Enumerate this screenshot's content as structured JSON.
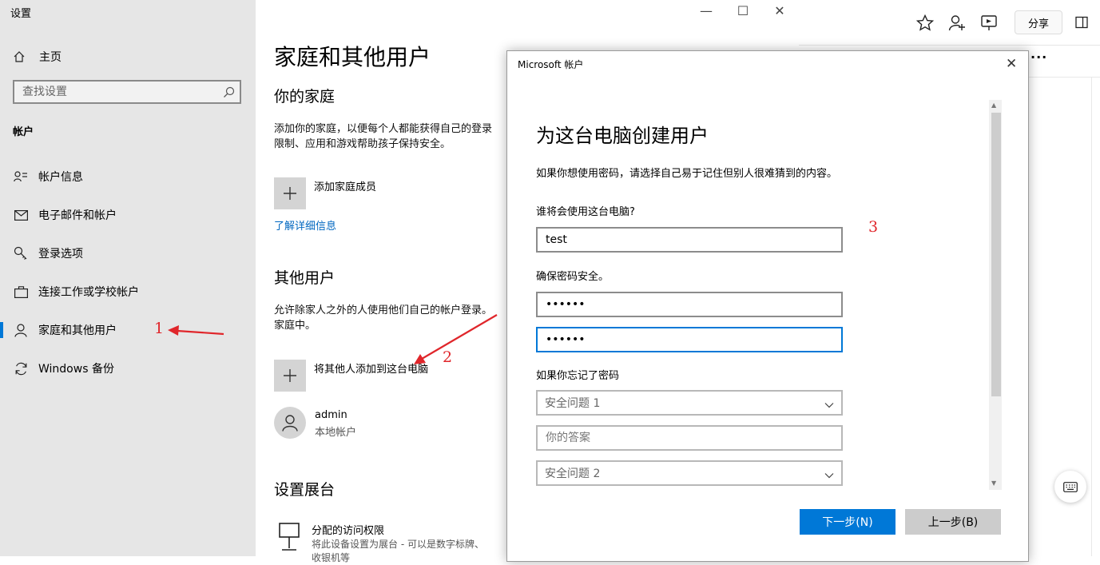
{
  "window": {
    "title": "设置"
  },
  "sidebar": {
    "home": "主页",
    "search_placeholder": "查找设置",
    "section": "帐户",
    "items": [
      {
        "label": "帐户信息",
        "icon": "person-card-icon"
      },
      {
        "label": "电子邮件和帐户",
        "icon": "mail-icon"
      },
      {
        "label": "登录选项",
        "icon": "key-icon"
      },
      {
        "label": "连接工作或学校帐户",
        "icon": "briefcase-icon"
      },
      {
        "label": "家庭和其他用户",
        "icon": "person-icon",
        "active": true
      },
      {
        "label": "Windows 备份",
        "icon": "sync-icon"
      }
    ]
  },
  "main": {
    "page_title": "家庭和其他用户",
    "family": {
      "heading": "你的家庭",
      "desc_line1": "添加你的家庭，以便每个人都能获得自己的登录",
      "desc_line2": "限制、应用和游戏帮助孩子保持安全。",
      "add_label": "添加家庭成员",
      "learn_more": "了解详细信息"
    },
    "others": {
      "heading": "其他用户",
      "desc_line1": "允许除家人之外的人使用他们自己的帐户登录。",
      "desc_line2": "家庭中。",
      "add_label": "将其他人添加到这台电脑"
    },
    "user": {
      "name": "admin",
      "type": "本地帐户"
    },
    "kiosk": {
      "heading": "设置展台",
      "item_title": "分配的访问权限",
      "item_desc": "将此设备设置为展台 - 可以是数字标牌、",
      "item_desc2": "收银机等"
    }
  },
  "browser": {
    "share_label": "分享",
    "more_label": "···"
  },
  "dialog": {
    "title": "Microsoft 帐户",
    "heading": "为这台电脑创建用户",
    "intro": "如果你想使用密码，请选择自己易于记住但别人很难猜到的内容。",
    "who_label": "谁将会使用这台电脑?",
    "username_value": "test",
    "password_label": "确保密码安全。",
    "password_value": "••••••",
    "confirm_value": "••••••",
    "forgot_label": "如果你忘记了密码",
    "question1": "安全问题 1",
    "answer_placeholder": "你的答案",
    "question2": "安全问题 2",
    "next_button": "下一步(N)",
    "back_button": "上一步(B)"
  },
  "annotations": {
    "a1": "1",
    "a2": "2",
    "a3": "3"
  },
  "colors": {
    "accent": "#0078d7",
    "annotation": "#e0262b",
    "sidebar_bg": "#e6e6e6"
  }
}
